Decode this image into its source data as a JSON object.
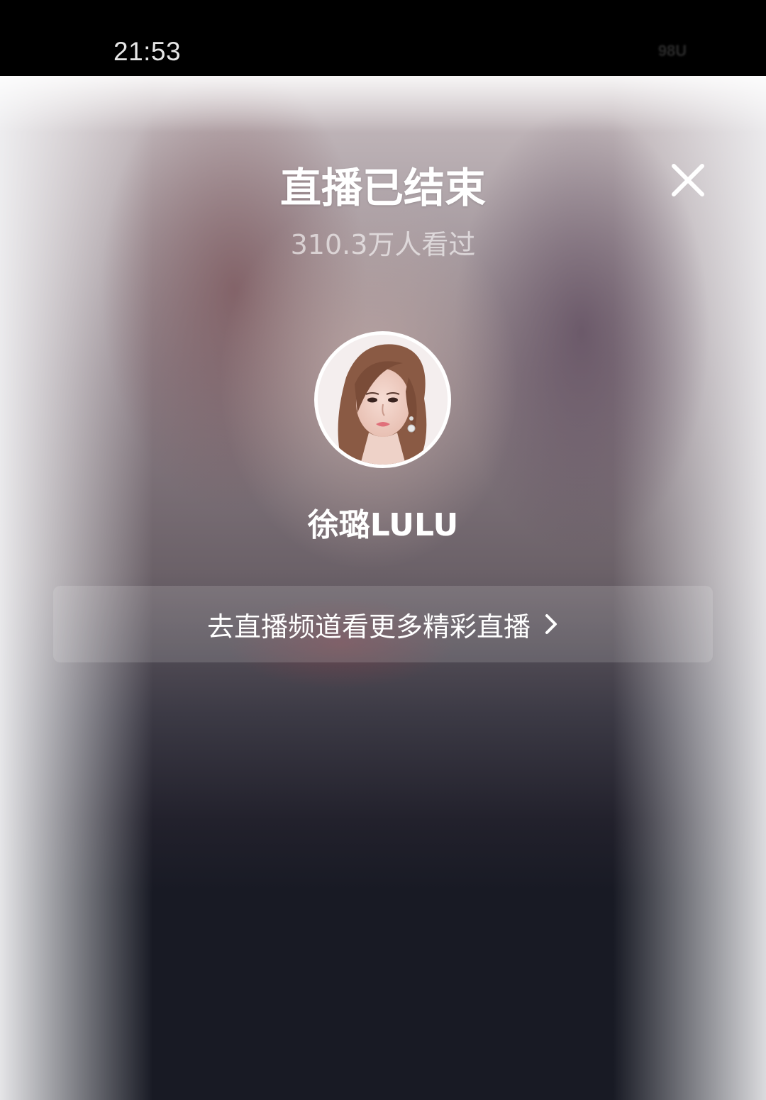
{
  "status_bar": {
    "time": "21:53",
    "indicator": "98U"
  },
  "live_ended": {
    "title": "直播已结束",
    "viewers": "310.3万人看过",
    "close_icon": "close-icon"
  },
  "streamer": {
    "name": "徐璐LULU",
    "avatar_icon": "avatar-photo"
  },
  "channel_button": {
    "label": "去直播频道看更多精彩直播",
    "icon": "chevron-right-icon"
  },
  "colors": {
    "background_dark": "#181a24",
    "text_primary": "#ffffff",
    "button_bg": "rgba(255,255,255,0.14)"
  }
}
